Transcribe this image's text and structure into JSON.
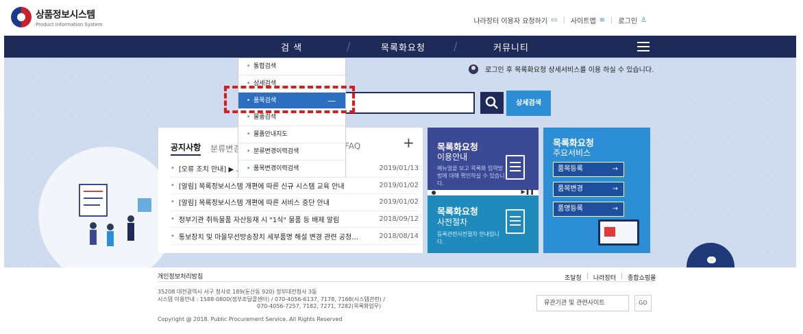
{
  "header": {
    "logo_title": "상품정보시스템",
    "logo_subtitle": "Product Information System",
    "util": {
      "request_use": "나라장터 이용자 요청하기",
      "sitemap": "사이트맵",
      "login": "로그인"
    }
  },
  "gnb": {
    "items": [
      "검  색",
      "목록화요청",
      "커뮤니티"
    ]
  },
  "search": {
    "login_message": "로그인 후 목록화요청 상세서비스를 이용 하실 수 있습니다.",
    "query": "",
    "detail_button": "상세검색",
    "dropdown": [
      "통합검색",
      "상세검색",
      "품목검색",
      "물품검색",
      "물품안내지도",
      "분류변경이력검색",
      "품목변경이력검색"
    ],
    "active_item": "품목검색"
  },
  "notice": {
    "tabs": [
      "공지사항",
      "분류변경",
      "FAQ"
    ],
    "rows": [
      {
        "title": "[오류 조치 안내] ▶ ...",
        "date": "2019/01/13"
      },
      {
        "title": "[알림] 목록정보시스템 개편에 따른 신규 시스템 교육 안내",
        "date": "2019/01/02"
      },
      {
        "title": "[알림] 목록정보시스템 개편에 따른 서비스 중단 안내",
        "date": "2019/01/02"
      },
      {
        "title": "정부기관 취득물품 자산등재 시 \"1식\" 물품 등 배제 알림",
        "date": "2018/09/12"
      },
      {
        "title": "통보장치 및 마을무선방송장치 세부품명 해설 변경 관련 공청…",
        "date": "2018/08/14"
      }
    ]
  },
  "cards": {
    "guide": {
      "title": "목록화요청",
      "subtitle": "이용안내",
      "desc": "메뉴얼을 보고 목록화 입력방법에 대해 확인하실 수 있습니다."
    },
    "procedure": {
      "title": "목록화요청",
      "subtitle": "사전절차",
      "desc": "등록관련사전절차 안내입니다."
    },
    "services": {
      "title": "목록화요청",
      "subtitle": "주요서비스",
      "buttons": [
        "품목등록",
        "품목변경",
        "품명등록"
      ]
    }
  },
  "footer": {
    "privacy": "개인정보처리방침",
    "links": [
      "조달청",
      "나라장터",
      "종합쇼핑몰"
    ],
    "address_lines": [
      "35208 대전광역시 서구 청사로 189(둔산동 920) 정부대전청사 3동",
      "시스템 이용안내 : 1588-0800(정부조달콜센터) / 070-4056-6137, 7178, 7168(시스템관련) /",
      "070-4056-7257, 7182, 7271, 7282(목록화업무)"
    ],
    "copyright": "Copyright @ 2018. Public Procurement Service. All Rights Reserved",
    "related_select": "유관기관 및 관련사이트",
    "go": "GO"
  }
}
